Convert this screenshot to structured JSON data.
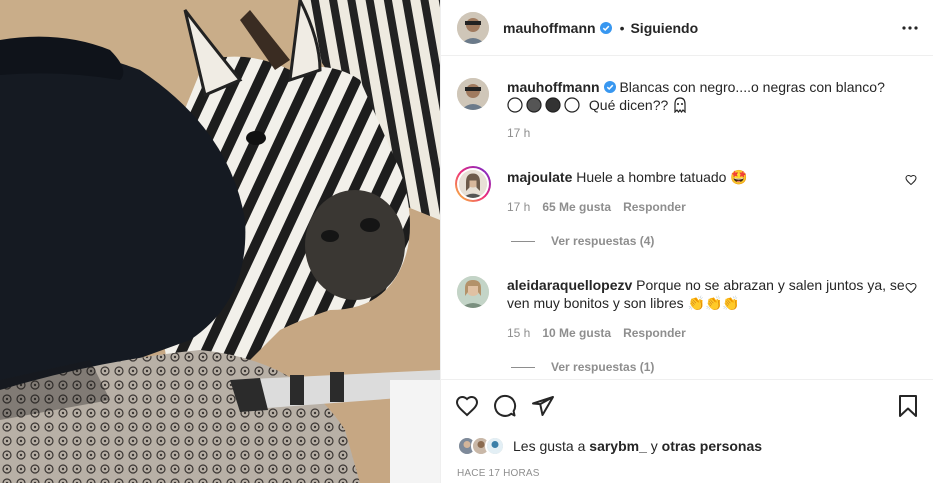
{
  "post": {
    "image_alt": "Zebra looking at the camera next to a person wearing a black bucket hat"
  },
  "header": {
    "username": "mauhoffmann",
    "dot": "•",
    "following": "Siguiendo"
  },
  "caption": {
    "username": "mauhoffmann",
    "text": "Blancas con negro....o negras con blanco?",
    "text2": "Qué dicen??",
    "time": "17 h"
  },
  "comments": [
    {
      "username": "majoulate",
      "text": "Huele a hombre tatuado",
      "emoji": "🤩",
      "time": "17 h",
      "likes": "65 Me gusta",
      "reply": "Responder",
      "view_replies": "Ver respuestas (4)"
    },
    {
      "username": "aleidaraquellopezv",
      "text": "Porque no se abrazan y salen juntos ya, se ven muy bonitos y son libres",
      "emoji": "👏👏👏",
      "time": "15 h",
      "likes": "10 Me gusta",
      "reply": "Responder",
      "view_replies": "Ver respuestas (1)"
    }
  ],
  "actions": {
    "liked_by_prefix": "Les gusta a",
    "liked_by_user": "sarybm_",
    "liked_by_join": "y",
    "liked_by_others": "otras personas",
    "timestamp": "Hace 17 horas"
  },
  "colors": {
    "verified": "#3897f0",
    "text": "#262626",
    "secondary": "#8e8e8e",
    "border": "#efefef"
  }
}
